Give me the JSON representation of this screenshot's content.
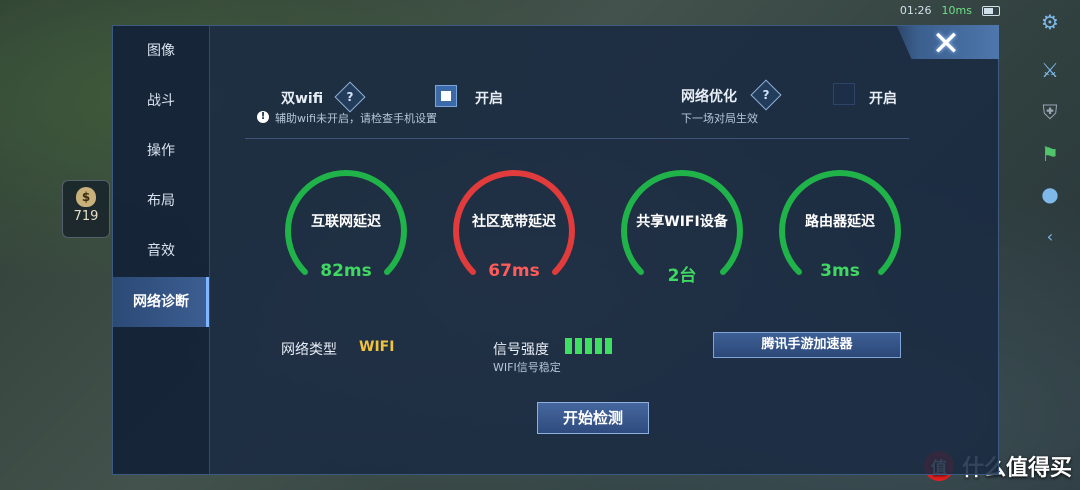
{
  "status": {
    "time": "01:26",
    "ping": "10ms"
  },
  "hud": {
    "gold": "719",
    "share_text": "什么值得买",
    "share_logo": "值"
  },
  "nav": {
    "items": [
      {
        "label": "图像"
      },
      {
        "label": "战斗"
      },
      {
        "label": "操作"
      },
      {
        "label": "布局"
      },
      {
        "label": "音效"
      },
      {
        "label": "网络诊断"
      }
    ],
    "active_index": 5
  },
  "close_label": "✕",
  "dual_wifi": {
    "title": "双wifi",
    "help": "?",
    "enabled": true,
    "toggle_label": "开启",
    "hint": "辅助wifi未开启，请检查手机设置"
  },
  "net_opt": {
    "title": "网络优化",
    "help": "?",
    "enabled": false,
    "toggle_label": "开启",
    "hint": "下一场对局生效"
  },
  "gauges": [
    {
      "label": "互联网延迟",
      "value": "82ms",
      "color": "#20b34a"
    },
    {
      "label": "社区宽带延迟",
      "value": "67ms",
      "color": "#e23b3b"
    },
    {
      "label": "共享WIFI设备",
      "value": "2台",
      "color": "#20b34a"
    },
    {
      "label": "路由器延迟",
      "value": "3ms",
      "color": "#20b34a"
    }
  ],
  "net_type": {
    "label": "网络类型",
    "value": "WIFI"
  },
  "signal": {
    "label": "信号强度",
    "bars": 5,
    "hint": "WIFI信号稳定"
  },
  "accelerator_button": "腾讯手游加速器",
  "start_button": "开始检测"
}
